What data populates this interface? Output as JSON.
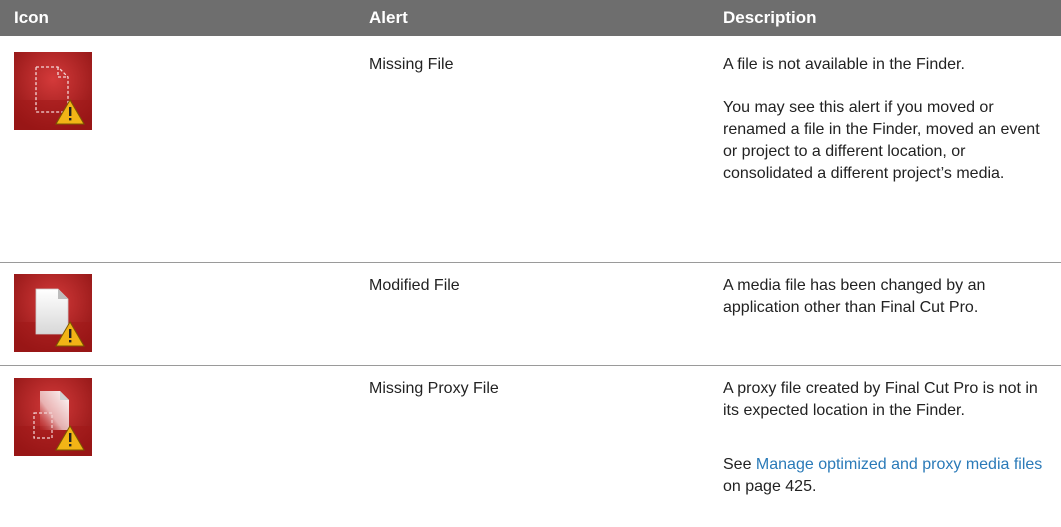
{
  "table": {
    "headers": {
      "icon": "Icon",
      "alert": "Alert",
      "description": "Description"
    },
    "rows": [
      {
        "icon": "missing-file-icon",
        "alert": "Missing File",
        "description_1": "A file is not available in the Finder.",
        "description_2": "You may see this alert if you moved or renamed a file in the Finder, moved an event or project to a different location, or consolidated a different project’s media."
      },
      {
        "icon": "modified-file-icon",
        "alert": "Modified File",
        "description_1": "A media file has been changed by an application other than Final Cut Pro."
      },
      {
        "icon": "missing-proxy-file-icon",
        "alert": "Missing Proxy File",
        "description_1": "A proxy file created by Final Cut Pro is not in its expected location in the Finder.",
        "see_prefix": "See",
        "link_text": "Manage optimized and proxy media files",
        "page_ref": "on page 425."
      }
    ]
  },
  "colors": {
    "header_bg": "#6e6e6e",
    "link": "#2a7ab8",
    "icon_red": "#b51e1e",
    "warning_yellow": "#f2b416"
  }
}
